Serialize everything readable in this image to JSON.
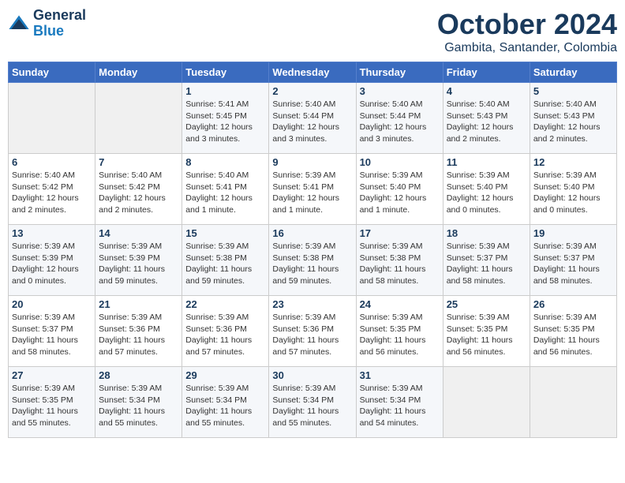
{
  "logo": {
    "text_general": "General",
    "text_blue": "Blue"
  },
  "header": {
    "month": "October 2024",
    "location": "Gambita, Santander, Colombia"
  },
  "weekdays": [
    "Sunday",
    "Monday",
    "Tuesday",
    "Wednesday",
    "Thursday",
    "Friday",
    "Saturday"
  ],
  "weeks": [
    [
      {
        "day": "",
        "detail": ""
      },
      {
        "day": "",
        "detail": ""
      },
      {
        "day": "1",
        "detail": "Sunrise: 5:41 AM\nSunset: 5:45 PM\nDaylight: 12 hours and 3 minutes."
      },
      {
        "day": "2",
        "detail": "Sunrise: 5:40 AM\nSunset: 5:44 PM\nDaylight: 12 hours and 3 minutes."
      },
      {
        "day": "3",
        "detail": "Sunrise: 5:40 AM\nSunset: 5:44 PM\nDaylight: 12 hours and 3 minutes."
      },
      {
        "day": "4",
        "detail": "Sunrise: 5:40 AM\nSunset: 5:43 PM\nDaylight: 12 hours and 2 minutes."
      },
      {
        "day": "5",
        "detail": "Sunrise: 5:40 AM\nSunset: 5:43 PM\nDaylight: 12 hours and 2 minutes."
      }
    ],
    [
      {
        "day": "6",
        "detail": "Sunrise: 5:40 AM\nSunset: 5:42 PM\nDaylight: 12 hours and 2 minutes."
      },
      {
        "day": "7",
        "detail": "Sunrise: 5:40 AM\nSunset: 5:42 PM\nDaylight: 12 hours and 2 minutes."
      },
      {
        "day": "8",
        "detail": "Sunrise: 5:40 AM\nSunset: 5:41 PM\nDaylight: 12 hours and 1 minute."
      },
      {
        "day": "9",
        "detail": "Sunrise: 5:39 AM\nSunset: 5:41 PM\nDaylight: 12 hours and 1 minute."
      },
      {
        "day": "10",
        "detail": "Sunrise: 5:39 AM\nSunset: 5:40 PM\nDaylight: 12 hours and 1 minute."
      },
      {
        "day": "11",
        "detail": "Sunrise: 5:39 AM\nSunset: 5:40 PM\nDaylight: 12 hours and 0 minutes."
      },
      {
        "day": "12",
        "detail": "Sunrise: 5:39 AM\nSunset: 5:40 PM\nDaylight: 12 hours and 0 minutes."
      }
    ],
    [
      {
        "day": "13",
        "detail": "Sunrise: 5:39 AM\nSunset: 5:39 PM\nDaylight: 12 hours and 0 minutes."
      },
      {
        "day": "14",
        "detail": "Sunrise: 5:39 AM\nSunset: 5:39 PM\nDaylight: 11 hours and 59 minutes."
      },
      {
        "day": "15",
        "detail": "Sunrise: 5:39 AM\nSunset: 5:38 PM\nDaylight: 11 hours and 59 minutes."
      },
      {
        "day": "16",
        "detail": "Sunrise: 5:39 AM\nSunset: 5:38 PM\nDaylight: 11 hours and 59 minutes."
      },
      {
        "day": "17",
        "detail": "Sunrise: 5:39 AM\nSunset: 5:38 PM\nDaylight: 11 hours and 58 minutes."
      },
      {
        "day": "18",
        "detail": "Sunrise: 5:39 AM\nSunset: 5:37 PM\nDaylight: 11 hours and 58 minutes."
      },
      {
        "day": "19",
        "detail": "Sunrise: 5:39 AM\nSunset: 5:37 PM\nDaylight: 11 hours and 58 minutes."
      }
    ],
    [
      {
        "day": "20",
        "detail": "Sunrise: 5:39 AM\nSunset: 5:37 PM\nDaylight: 11 hours and 58 minutes."
      },
      {
        "day": "21",
        "detail": "Sunrise: 5:39 AM\nSunset: 5:36 PM\nDaylight: 11 hours and 57 minutes."
      },
      {
        "day": "22",
        "detail": "Sunrise: 5:39 AM\nSunset: 5:36 PM\nDaylight: 11 hours and 57 minutes."
      },
      {
        "day": "23",
        "detail": "Sunrise: 5:39 AM\nSunset: 5:36 PM\nDaylight: 11 hours and 57 minutes."
      },
      {
        "day": "24",
        "detail": "Sunrise: 5:39 AM\nSunset: 5:35 PM\nDaylight: 11 hours and 56 minutes."
      },
      {
        "day": "25",
        "detail": "Sunrise: 5:39 AM\nSunset: 5:35 PM\nDaylight: 11 hours and 56 minutes."
      },
      {
        "day": "26",
        "detail": "Sunrise: 5:39 AM\nSunset: 5:35 PM\nDaylight: 11 hours and 56 minutes."
      }
    ],
    [
      {
        "day": "27",
        "detail": "Sunrise: 5:39 AM\nSunset: 5:35 PM\nDaylight: 11 hours and 55 minutes."
      },
      {
        "day": "28",
        "detail": "Sunrise: 5:39 AM\nSunset: 5:34 PM\nDaylight: 11 hours and 55 minutes."
      },
      {
        "day": "29",
        "detail": "Sunrise: 5:39 AM\nSunset: 5:34 PM\nDaylight: 11 hours and 55 minutes."
      },
      {
        "day": "30",
        "detail": "Sunrise: 5:39 AM\nSunset: 5:34 PM\nDaylight: 11 hours and 55 minutes."
      },
      {
        "day": "31",
        "detail": "Sunrise: 5:39 AM\nSunset: 5:34 PM\nDaylight: 11 hours and 54 minutes."
      },
      {
        "day": "",
        "detail": ""
      },
      {
        "day": "",
        "detail": ""
      }
    ]
  ]
}
